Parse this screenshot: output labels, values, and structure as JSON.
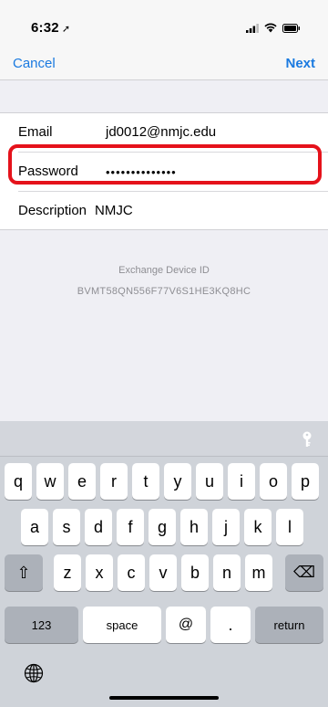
{
  "status": {
    "time": "6:32",
    "location_glyph": "➚"
  },
  "nav": {
    "cancel_label": "Cancel",
    "next_label": "Next"
  },
  "form": {
    "email_label": "Email",
    "email_value": "jd0012@nmjc.edu",
    "password_label": "Password",
    "password_value": "••••••••••••••",
    "description_label": "Description",
    "description_value": "NMJC"
  },
  "device": {
    "title": "Exchange Device ID",
    "value": "BVMT58QN556F77V6S1HE3KQ8HC"
  },
  "keyboard": {
    "row1": [
      "q",
      "w",
      "e",
      "r",
      "t",
      "y",
      "u",
      "i",
      "o",
      "p"
    ],
    "row2": [
      "a",
      "s",
      "d",
      "f",
      "g",
      "h",
      "j",
      "k",
      "l"
    ],
    "row3": [
      "z",
      "x",
      "c",
      "v",
      "b",
      "n",
      "m"
    ],
    "numbers_label": "123",
    "space_label": "space",
    "at_label": "@",
    "dot_label": ".",
    "return_label": "return",
    "shift_icon": "⇧",
    "delete_icon": "⌫"
  },
  "icons": {
    "signal": "signal-icon",
    "wifi": "wifi-icon",
    "battery": "battery-icon",
    "key": "key-icon",
    "globe": "globe-icon"
  },
  "colors": {
    "accent": "#1a7ae0",
    "highlight": "#e5121b"
  }
}
